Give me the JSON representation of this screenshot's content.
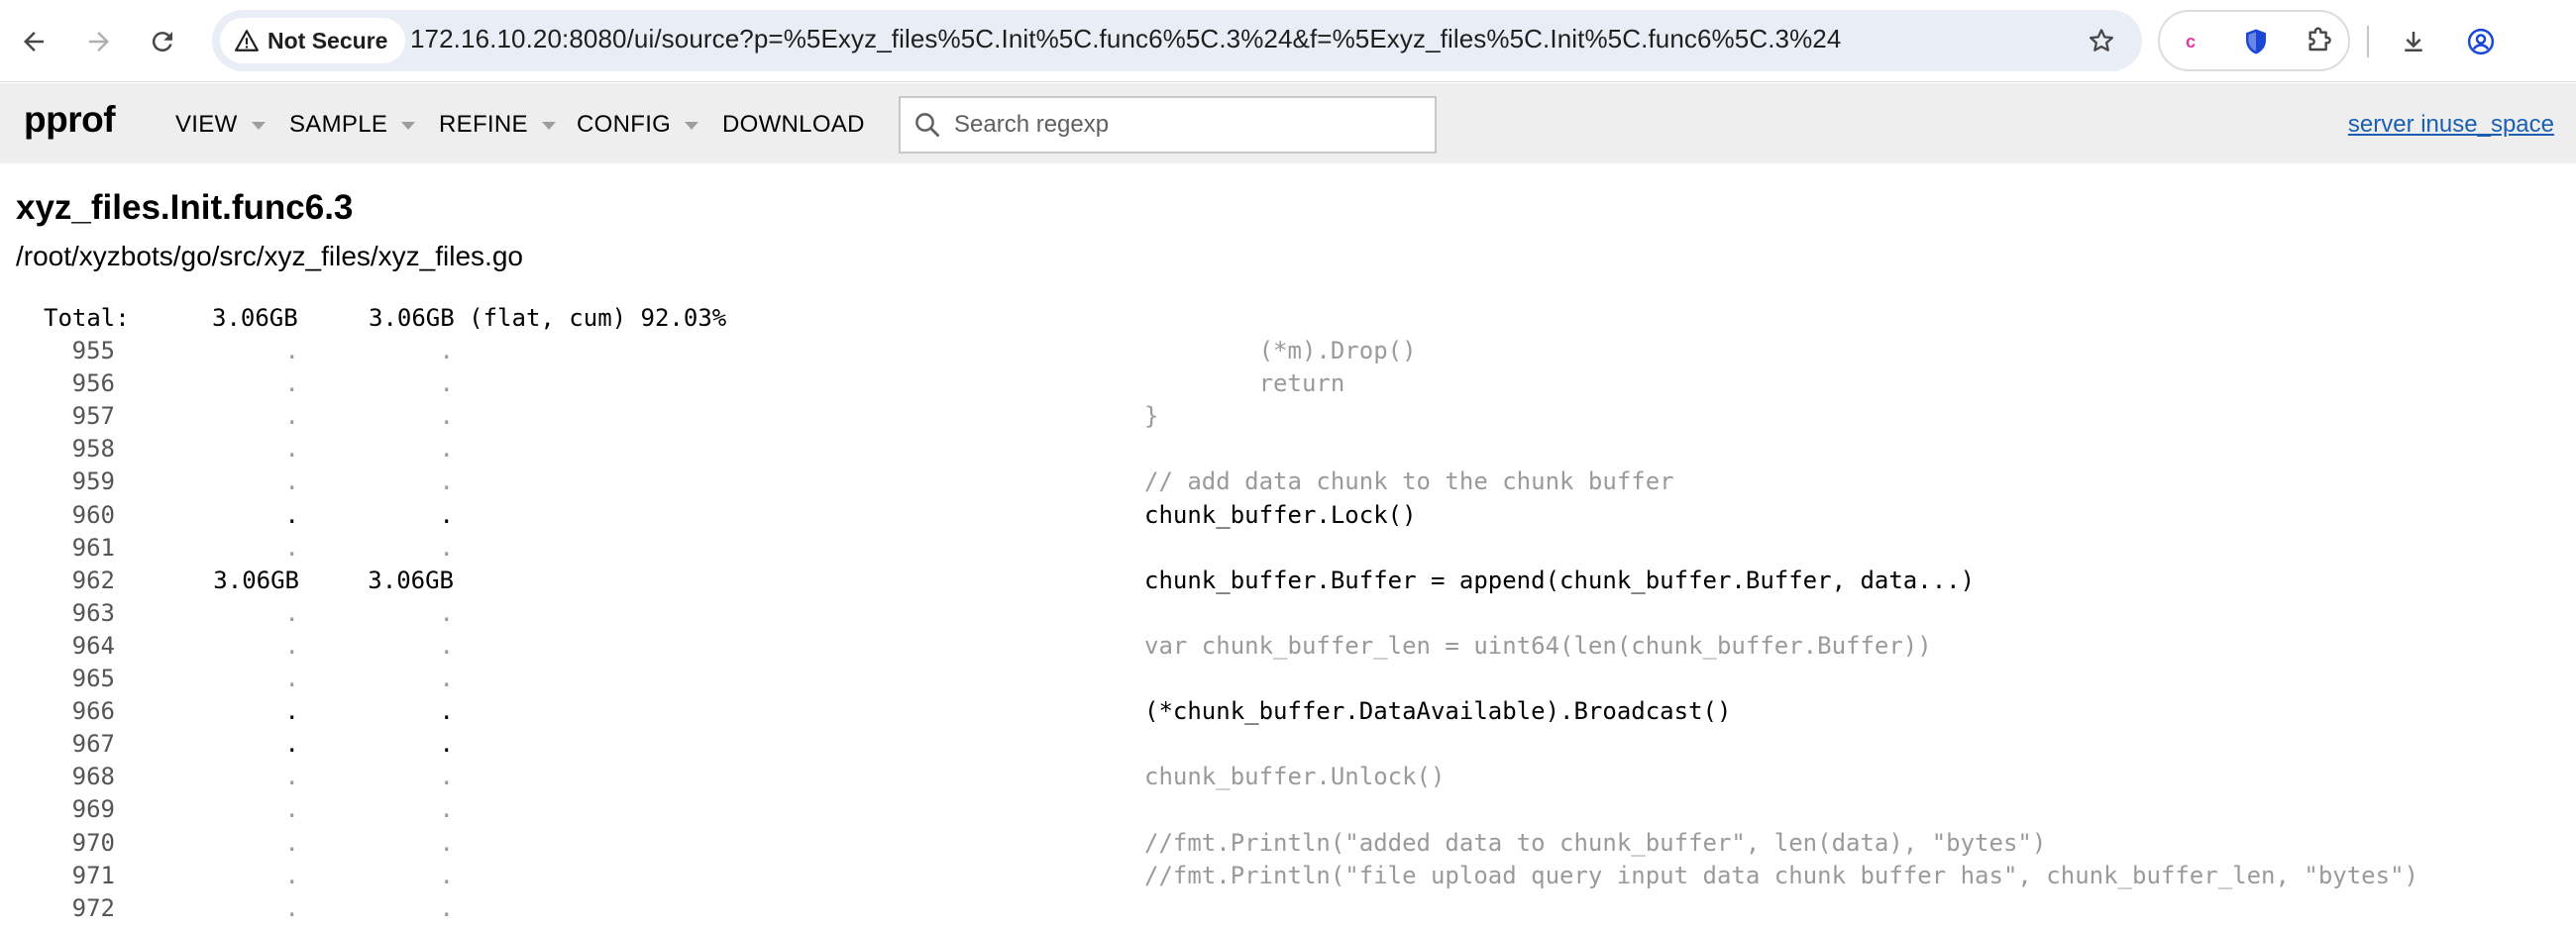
{
  "browser": {
    "security_label": "Not Secure",
    "url": "172.16.10.20:8080/ui/source?p=%5Exyz_files%5C.Init%5C.func6%5C.3%24&f=%5Exyz_files%5C.Init%5C.func6%5C.3%24",
    "icons": [
      "back-arrow-icon",
      "forward-arrow-icon",
      "reload-icon",
      "warning-triangle-icon",
      "star-icon",
      "extension-c-icon",
      "shield-icon",
      "puzzle-icon",
      "download-icon",
      "profile-icon"
    ]
  },
  "pprof": {
    "logo": "pprof",
    "menus": [
      {
        "label": "VIEW"
      },
      {
        "label": "SAMPLE"
      },
      {
        "label": "REFINE"
      },
      {
        "label": "CONFIG"
      }
    ],
    "download_label": "DOWNLOAD",
    "search_placeholder": "Search regexp",
    "server_link": "server inuse_space"
  },
  "source": {
    "function_name": "xyz_files.Init.func6.3",
    "file_path": "/root/xyzbots/go/src/xyz_files/xyz_files.go",
    "total_label": "Total:",
    "total_flat": "3.06GB",
    "total_rest": "3.06GB (flat, cum) 92.03%",
    "lines": [
      {
        "num": "955",
        "flat": ".",
        "cum": ".",
        "code": "        (*m).Drop()",
        "hot": false
      },
      {
        "num": "956",
        "flat": ".",
        "cum": ".",
        "code": "        return",
        "hot": false
      },
      {
        "num": "957",
        "flat": ".",
        "cum": ".",
        "code": "}",
        "hot": false
      },
      {
        "num": "958",
        "flat": ".",
        "cum": ".",
        "code": "",
        "hot": false
      },
      {
        "num": "959",
        "flat": ".",
        "cum": ".",
        "code": "// add data chunk to the chunk buffer",
        "hot": false
      },
      {
        "num": "960",
        "flat": ".",
        "cum": ".",
        "code": "chunk_buffer.Lock()",
        "hot": true
      },
      {
        "num": "961",
        "flat": ".",
        "cum": ".",
        "code": "",
        "hot": false
      },
      {
        "num": "962",
        "flat": "3.06GB",
        "cum": "3.06GB",
        "code": "chunk_buffer.Buffer = append(chunk_buffer.Buffer, data...)",
        "hot": true
      },
      {
        "num": "963",
        "flat": ".",
        "cum": ".",
        "code": "",
        "hot": false
      },
      {
        "num": "964",
        "flat": ".",
        "cum": ".",
        "code": "var chunk_buffer_len = uint64(len(chunk_buffer.Buffer))",
        "hot": false
      },
      {
        "num": "965",
        "flat": ".",
        "cum": ".",
        "code": "",
        "hot": false
      },
      {
        "num": "966",
        "flat": ".",
        "cum": ".",
        "code": "(*chunk_buffer.DataAvailable).Broadcast()",
        "hot": true
      },
      {
        "num": "967",
        "flat": ".",
        "cum": ".",
        "code": "",
        "hot": true
      },
      {
        "num": "968",
        "flat": ".",
        "cum": ".",
        "code": "chunk_buffer.Unlock()",
        "hot": false
      },
      {
        "num": "969",
        "flat": ".",
        "cum": ".",
        "code": "",
        "hot": false
      },
      {
        "num": "970",
        "flat": ".",
        "cum": ".",
        "code": "//fmt.Println(\"added data to chunk_buffer\", len(data), \"bytes\")",
        "hot": false
      },
      {
        "num": "971",
        "flat": ".",
        "cum": ".",
        "code": "//fmt.Println(\"file upload query input data chunk buffer has\", chunk_buffer_len, \"bytes\")",
        "hot": false
      },
      {
        "num": "972",
        "flat": ".",
        "cum": ".",
        "code": "",
        "hot": false
      }
    ]
  },
  "colors": {
    "link": "#1a5fb4",
    "dim_code": "#9a9a9a",
    "header_bg": "#eeeeee"
  }
}
